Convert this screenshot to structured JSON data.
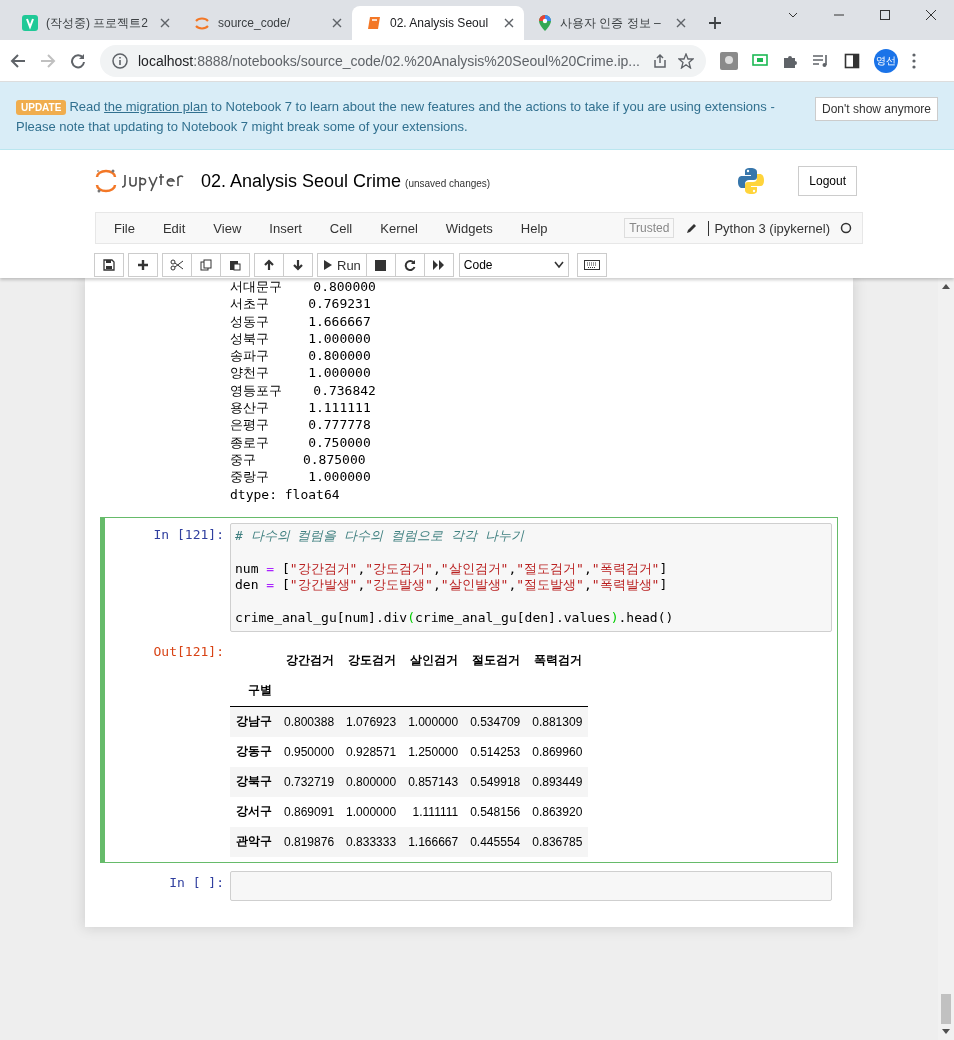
{
  "browser": {
    "tabs": [
      {
        "title": "(작성중) 프로젝트2",
        "kind": "vlog",
        "selected": false
      },
      {
        "title": "source_code/",
        "kind": "jupyter",
        "selected": false
      },
      {
        "title": "02. Analysis Seoul",
        "kind": "notebook",
        "selected": true
      },
      {
        "title": "사용자 인증 정보 –",
        "kind": "maps",
        "selected": false
      }
    ],
    "url_host": "localhost",
    "url_rest": ":8888/notebooks/source_code/02.%20Analysis%20Seoul%20Crime.ip...",
    "profile": "영선"
  },
  "banner": {
    "badge": "UPDATE",
    "text_before": "Read ",
    "link": "the migration plan",
    "text_after": " to Notebook 7 to learn about the new features and the actions to take if you are using extensions - Please note that updating to Notebook 7 might break some of your extensions.",
    "button": "Don't show anymore"
  },
  "header": {
    "title": "02. Analysis Seoul Crime",
    "save_status": "(unsaved changes)",
    "logout": "Logout"
  },
  "menu": {
    "items": [
      "File",
      "Edit",
      "View",
      "Insert",
      "Cell",
      "Kernel",
      "Widgets",
      "Help"
    ],
    "trusted": "Trusted",
    "kernel": "Python 3 (ipykernel)"
  },
  "toolbar": {
    "run": "Run",
    "cell_type": "Code"
  },
  "previous_output": [
    "서대문구    0.800000",
    "서초구     0.769231",
    "성동구     1.666667",
    "성북구     1.000000",
    "송파구     0.800000",
    "양천구     1.000000",
    "영등포구    0.736842",
    "용산구     1.111111",
    "은평구     0.777778",
    "종로구     0.750000",
    "중구      0.875000",
    "중랑구     1.000000",
    "dtype: float64"
  ],
  "cells": [
    {
      "prompt": "In [121]:",
      "selected": true,
      "code": [
        {
          "tokens": [
            {
              "kind": "comment",
              "text": "# 다수의 컬럼을 다수의 컬럼으로 각각 나누기"
            }
          ]
        },
        {
          "gap_before": true,
          "tokens": [
            {
              "kind": "plain",
              "text": "num "
            },
            {
              "kind": "op",
              "text": "="
            },
            {
              "kind": "plain",
              "text": " ["
            },
            {
              "kind": "string",
              "text": "\"강간검거\""
            },
            {
              "kind": "plain",
              "text": ","
            },
            {
              "kind": "string",
              "text": "\"강도검거\""
            },
            {
              "kind": "plain",
              "text": ","
            },
            {
              "kind": "string",
              "text": "\"살인검거\""
            },
            {
              "kind": "plain",
              "text": ","
            },
            {
              "kind": "string",
              "text": "\"절도검거\""
            },
            {
              "kind": "plain",
              "text": ","
            },
            {
              "kind": "string",
              "text": "\"폭력검거\""
            },
            {
              "kind": "plain",
              "text": "]"
            }
          ]
        },
        {
          "tokens": [
            {
              "kind": "plain",
              "text": "den "
            },
            {
              "kind": "op",
              "text": "="
            },
            {
              "kind": "plain",
              "text": " ["
            },
            {
              "kind": "string",
              "text": "\"강간발생\""
            },
            {
              "kind": "plain",
              "text": ","
            },
            {
              "kind": "string",
              "text": "\"강도발생\""
            },
            {
              "kind": "plain",
              "text": ","
            },
            {
              "kind": "string",
              "text": "\"살인발생\""
            },
            {
              "kind": "plain",
              "text": ","
            },
            {
              "kind": "string",
              "text": "\"절도발생\""
            },
            {
              "kind": "plain",
              "text": ","
            },
            {
              "kind": "string",
              "text": "\"폭력발생\""
            },
            {
              "kind": "plain",
              "text": "]"
            }
          ]
        },
        {
          "gap_before": true,
          "tokens": [
            {
              "kind": "plain",
              "text": "crime_anal_gu[num].div"
            },
            {
              "kind": "paren",
              "text": "("
            },
            {
              "kind": "plain",
              "text": "crime_anal_gu[den].values"
            },
            {
              "kind": "paren",
              "text": ")"
            },
            {
              "kind": "plain",
              "text": ".head()"
            }
          ]
        }
      ],
      "out_prompt": "Out[121]:",
      "table": {
        "columns": [
          "",
          "강간검거",
          "강도검거",
          "살인검거",
          "절도검거",
          "폭력검거"
        ],
        "index_name": "구별",
        "rows": [
          [
            "강남구",
            "0.800388",
            "1.076923",
            "1.000000",
            "0.534709",
            "0.881309"
          ],
          [
            "강동구",
            "0.950000",
            "0.928571",
            "1.250000",
            "0.514253",
            "0.869960"
          ],
          [
            "강북구",
            "0.732719",
            "0.800000",
            "0.857143",
            "0.549918",
            "0.893449"
          ],
          [
            "강서구",
            "0.869091",
            "1.000000",
            "1.111111",
            "0.548156",
            "0.863920"
          ],
          [
            "관악구",
            "0.819876",
            "0.833333",
            "1.166667",
            "0.445554",
            "0.836785"
          ]
        ]
      }
    },
    {
      "prompt": "In [ ]:",
      "selected": false
    }
  ]
}
